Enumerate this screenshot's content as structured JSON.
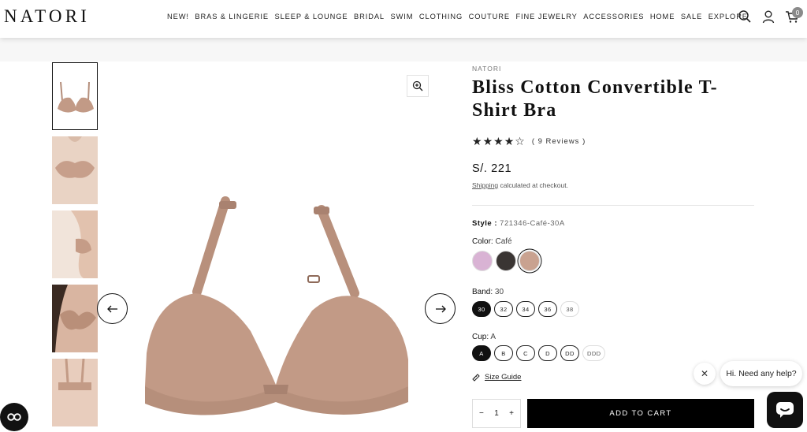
{
  "header": {
    "logo": "NATORI",
    "nav": [
      "NEW!",
      "BRAS & LINGERIE",
      "SLEEP & LOUNGE",
      "BRIDAL",
      "SWIM",
      "CLOTHING",
      "COUTURE",
      "FINE JEWELRY",
      "ACCESSORIES",
      "HOME",
      "SALE",
      "EXPLORE"
    ],
    "icons": [
      "search-icon",
      "account-icon",
      "cart-icon"
    ],
    "cart_count": "0"
  },
  "product": {
    "brand": "NATORI",
    "title": "Bliss Cotton Convertible T-Shirt Bra",
    "rating": 4,
    "rating_max": 5,
    "reviews_label": "( 9 Reviews )",
    "price": "S/. 221",
    "shipping_link": "Shipping",
    "shipping_rest": " calculated at checkout.",
    "style_label": "Style :",
    "style_value": "721346-Café-30A",
    "color_label": "Color:",
    "color_value": "Café",
    "colors": [
      {
        "name": "lilac",
        "hex": "#d9b3d4"
      },
      {
        "name": "charcoal",
        "hex": "#3a3533"
      },
      {
        "name": "cafe",
        "hex": "#c9a290"
      }
    ],
    "band_label": "Band:",
    "band_value": "30",
    "bands": [
      "30",
      "32",
      "34",
      "36",
      "38"
    ],
    "cup_label": "Cup:",
    "cup_value": "A",
    "cups": [
      "A",
      "B",
      "C",
      "D",
      "DD",
      "DDD"
    ],
    "size_guide": "Size Guide",
    "quantity": "1",
    "qty_minus": "−",
    "qty_plus": "+",
    "add_to_cart": "ADD TO CART"
  },
  "chat": {
    "greeting": "Hi. Need any help?",
    "close": "✕"
  },
  "colors": {
    "accent": "#000000",
    "product_tone": "#c29a86"
  }
}
